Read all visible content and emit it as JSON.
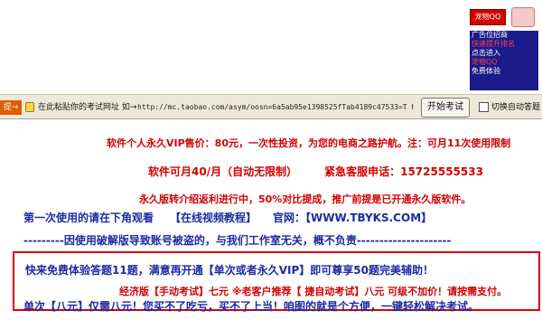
{
  "ad": {
    "button_label": "宠物QQ",
    "image_lines": [
      "广告位招商",
      "快速提升排名",
      "点击进入",
      "宠物QQ",
      "免费体验"
    ]
  },
  "toolbar": {
    "left_label": "提→",
    "text": "在此粘贴你的考试网址 如→",
    "url": "http://mc.taobao.com/asym/oosn=6a5ab95e1398525fTab4189c47533=T htm",
    "start_button": "开始考试",
    "checkbox_label": "切换自动答题"
  },
  "content": {
    "line1": "软件个人永久VIP售价：80元，一次性投资，为您的电商之路护航。注：可月11次使用限制",
    "line2_a": "软件可月40/月（自动无限制）",
    "line2_b": "紧急客服申话：15725555533",
    "line3": "永久版转介绍返利进行中，50%对比提成，推广前提是已开通永久版软件。",
    "line4_a": "第一次使用的请在下角观看",
    "line4_b": "【在线视频教程】",
    "line4_c": "官网：【WWW.TBYKS.COM】",
    "line5": "---------因使用破解版导致账号被盗的，与我们工作室无关，概不负责---------------------",
    "box_line1": "快来免费体验答题11题，满意再开通【单次或者永久VIP】即可尊享50题完美辅助！",
    "box_line2": "经济版【手动考试】七元  ※老客户推荐【  捷自动考试】八元 可级不加价！请按需支付。",
    "box_line3": "单次【八元】仅需八元！您买不了吃亏，买不了上当！咱图的就是个方便，一键轻松解决考试。"
  }
}
